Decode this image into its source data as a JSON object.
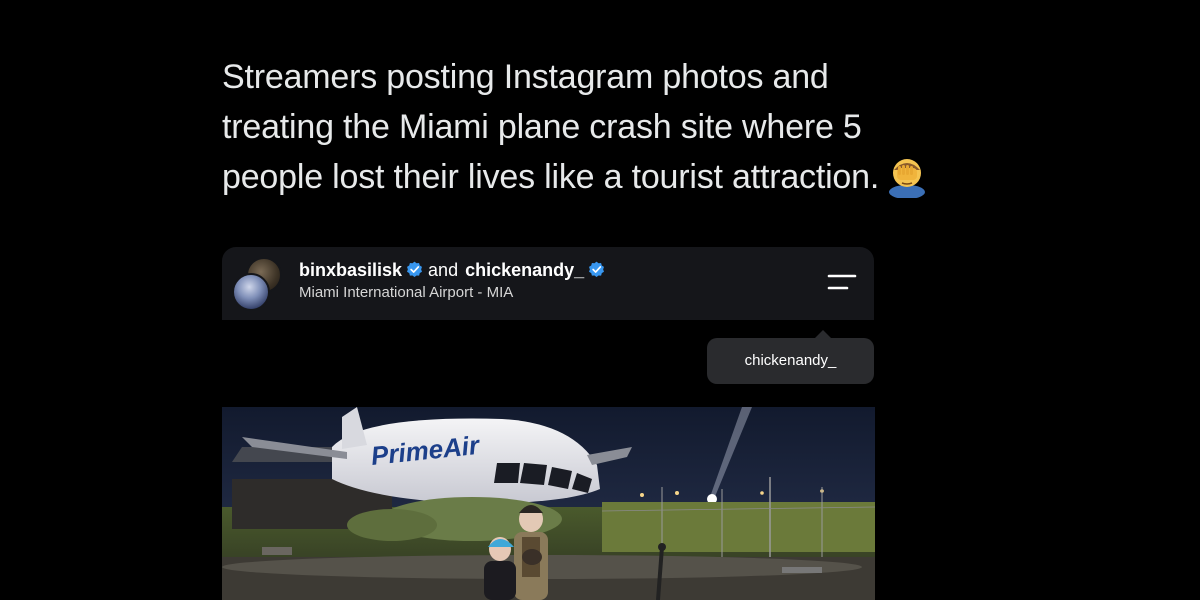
{
  "tweet": {
    "line1": "Streamers posting Instagram photos and",
    "line2": "treating the Miami plane crash site where 5",
    "line3": "people lost their lives like a tourist attraction.",
    "emoji": "face-palm-emoji"
  },
  "instagram": {
    "user1": "binxbasilisk",
    "connector": "and",
    "user2": "chickenandy_",
    "location": "Miami International Airport - MIA",
    "tag_label": "chickenandy_",
    "verified_color": "#3897f0",
    "menu_icon": "menu-icon"
  },
  "photo": {
    "description_icon": "plane-crash-photo"
  }
}
